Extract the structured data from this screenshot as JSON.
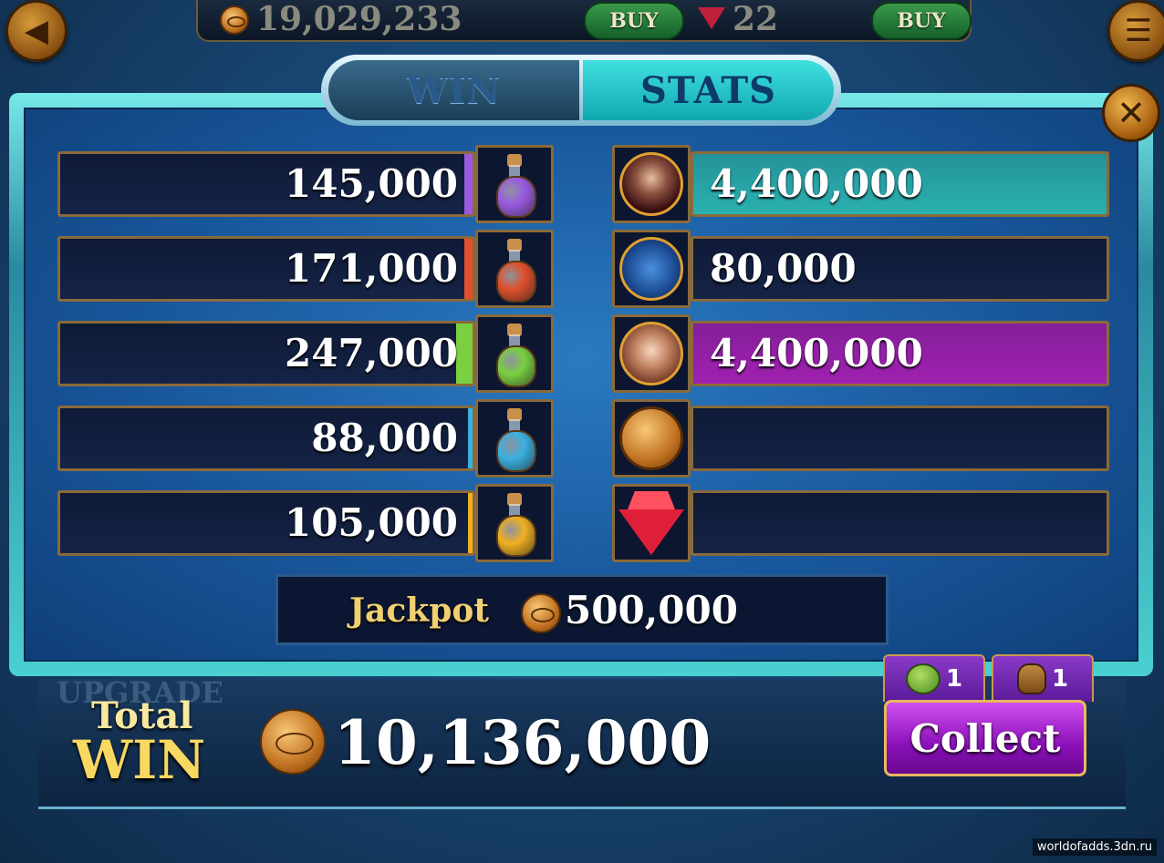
{
  "topbar": {
    "coins": "19,029,233",
    "buy_label_1": "BUY",
    "gems": "22",
    "buy_label_2": "BUY"
  },
  "tabs": {
    "win_label": "WIN",
    "stats_label": "STATS"
  },
  "potions": [
    {
      "value": "145,000",
      "color": "#9a5ae0",
      "bar_fill": 0.02
    },
    {
      "value": "171,000",
      "color": "#e0502a",
      "bar_fill": 0.02
    },
    {
      "value": "247,000",
      "color": "#7ad040",
      "bar_fill": 0.04
    },
    {
      "value": "88,000",
      "color": "#3ab0e0",
      "bar_fill": 0.01
    },
    {
      "value": "105,000",
      "color": "#f0b020",
      "bar_fill": 0.01
    }
  ],
  "characters": [
    {
      "value": "4,400,000",
      "avatar": "vampire-portrait",
      "bar_color": "#2ab0b0",
      "bar_fill": 1.0
    },
    {
      "value": "80,000",
      "avatar": "wolf-portrait",
      "bar_color": "#2ab0b0",
      "bar_fill": 0.0
    },
    {
      "value": "4,400,000",
      "avatar": "elf-portrait",
      "bar_color": "#a020b0",
      "bar_fill": 1.0
    },
    {
      "value": "",
      "avatar": "eye-coin-icon",
      "bar_color": "#2ab0b0",
      "bar_fill": 0.0
    },
    {
      "value": "",
      "avatar": "ruby-gem-icon",
      "bar_color": "#2ab0b0",
      "bar_fill": 0.0
    }
  ],
  "jackpot": {
    "label": "Jackpot",
    "value": "500,000"
  },
  "total": {
    "label_line1": "Total",
    "label_line2": "WIN",
    "value": "10,136,000"
  },
  "background_labels": {
    "upgrade": "UPGRADE"
  },
  "items": [
    {
      "icon": "pumpkin-icon",
      "count": "1"
    },
    {
      "icon": "potion-bag-icon",
      "count": "1"
    }
  ],
  "collect_label": "Collect",
  "watermark": "worldofadds.3dn.ru"
}
